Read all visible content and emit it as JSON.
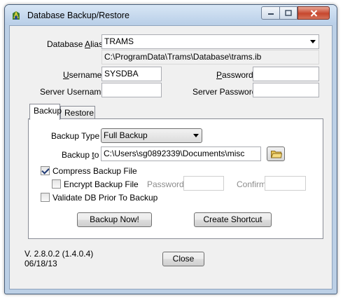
{
  "window": {
    "title": "Database Backup/Restore"
  },
  "title_buttons": {
    "minimize_icon": "minimize-icon",
    "maximize_icon": "maximize-icon",
    "close_icon": "close-icon"
  },
  "form": {
    "alias_label_prefix": "Database ",
    "alias_label_accel": "A",
    "alias_label_suffix": "lias",
    "alias_value": "TRAMS",
    "path_value": "C:\\ProgramData\\Trams\\Database\\trams.ib",
    "username_label_accel": "U",
    "username_label_rest": "sername",
    "username_value": "SYSDBA",
    "password_label_accel": "P",
    "password_label_rest": "assword",
    "password_value": "",
    "server_username_label": "Server Username",
    "server_username_value": "",
    "server_password_label": "Server Password",
    "server_password_value": ""
  },
  "tabs": [
    {
      "label": "Backup",
      "active": true
    },
    {
      "label": "Restore",
      "active": false
    }
  ],
  "backup": {
    "type_label": "Backup Type",
    "type_value": "Full Backup",
    "to_label_prefix": "Backup ",
    "to_label_accel": "t",
    "to_label_suffix": "o",
    "to_value": "C:\\Users\\sg0892339\\Documents\\misc",
    "compress_label": "Compress Backup File",
    "compress_checked": true,
    "encrypt_label": "Encrypt Backup File",
    "encrypt_checked": false,
    "password_label": "Password",
    "confirm_label": "Confirm",
    "validate_label": "Validate DB Prior To Backup",
    "validate_checked": false,
    "backup_now_label": "Backup Now!",
    "create_shortcut_label": "Create Shortcut"
  },
  "footer": {
    "version": "V. 2.8.0.2 (1.4.0.4)",
    "date": "06/18/13",
    "close_label": "Close"
  }
}
